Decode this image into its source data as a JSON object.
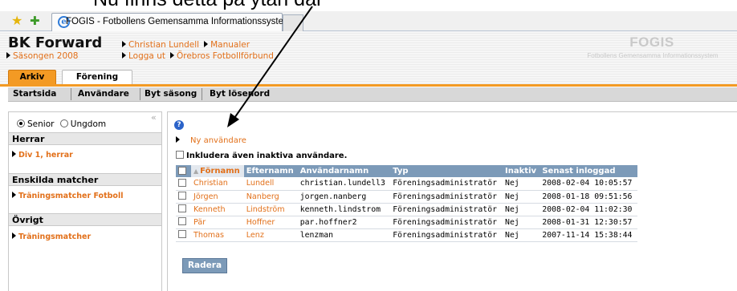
{
  "caption_fragment": "Nu finns detta på ytan där",
  "browser": {
    "tab_title": "FOGIS - Fotbollens Gemensamma Informationssystem"
  },
  "header": {
    "club_name": "BK Forward",
    "season_link": "Säsongen 2008",
    "user_link": "Christian Lundell",
    "manuals_link": "Manualer",
    "logout_link": "Logga ut",
    "federation_link": "Örebros Fotbollförbund",
    "logo_title": "FOGIS",
    "logo_subtitle": "Fotbollens Gemensamma Informationssystem",
    "tabs": [
      {
        "label": "Arkiv",
        "active": true
      },
      {
        "label": "Förening",
        "active": false
      }
    ]
  },
  "subnav": {
    "items": [
      "Startsida",
      "Användare",
      "Byt säsong",
      "Byt lösenord"
    ]
  },
  "sidebar": {
    "radio_senior": "Senior",
    "radio_ungdom": "Ungdom",
    "sections": [
      {
        "heading": "Herrar",
        "link": "Div 1, herrar"
      },
      {
        "heading": "Enskilda matcher",
        "link": "Träningsmatcher Fotboll"
      },
      {
        "heading": "Övrigt",
        "link": "Träningsmatcher"
      }
    ]
  },
  "content": {
    "new_user_link": "Ny användare",
    "include_inactive_label": "Inkludera även inaktiva användare.",
    "delete_button": "Radera",
    "columns": [
      "Förnamn",
      "Efternamn",
      "Användarnamn",
      "Typ",
      "Inaktiv",
      "Senast inloggad"
    ],
    "rows": [
      {
        "first": "Christian",
        "last": "Lundell",
        "username": "christian.lundell3",
        "type": "Föreningsadministratör",
        "inactive": "Nej",
        "last_login": "2008-02-04 10:05:57"
      },
      {
        "first": "Jörgen",
        "last": "Nanberg",
        "username": "jorgen.nanberg",
        "type": "Föreningsadministratör",
        "inactive": "Nej",
        "last_login": "2008-01-18 09:51:56"
      },
      {
        "first": "Kenneth",
        "last": "Lindström",
        "username": "kenneth.lindstrom",
        "type": "Föreningsadministratör",
        "inactive": "Nej",
        "last_login": "2008-02-04 11:02:30"
      },
      {
        "first": "Pär",
        "last": "Hoffner",
        "username": "par.hoffner2",
        "type": "Föreningsadministratör",
        "inactive": "Nej",
        "last_login": "2008-01-31 12:30:57"
      },
      {
        "first": "Thomas",
        "last": "Lenz",
        "username": "lenzman",
        "type": "Föreningsadministratör",
        "inactive": "Nej",
        "last_login": "2007-11-14 15:38:44"
      }
    ]
  }
}
